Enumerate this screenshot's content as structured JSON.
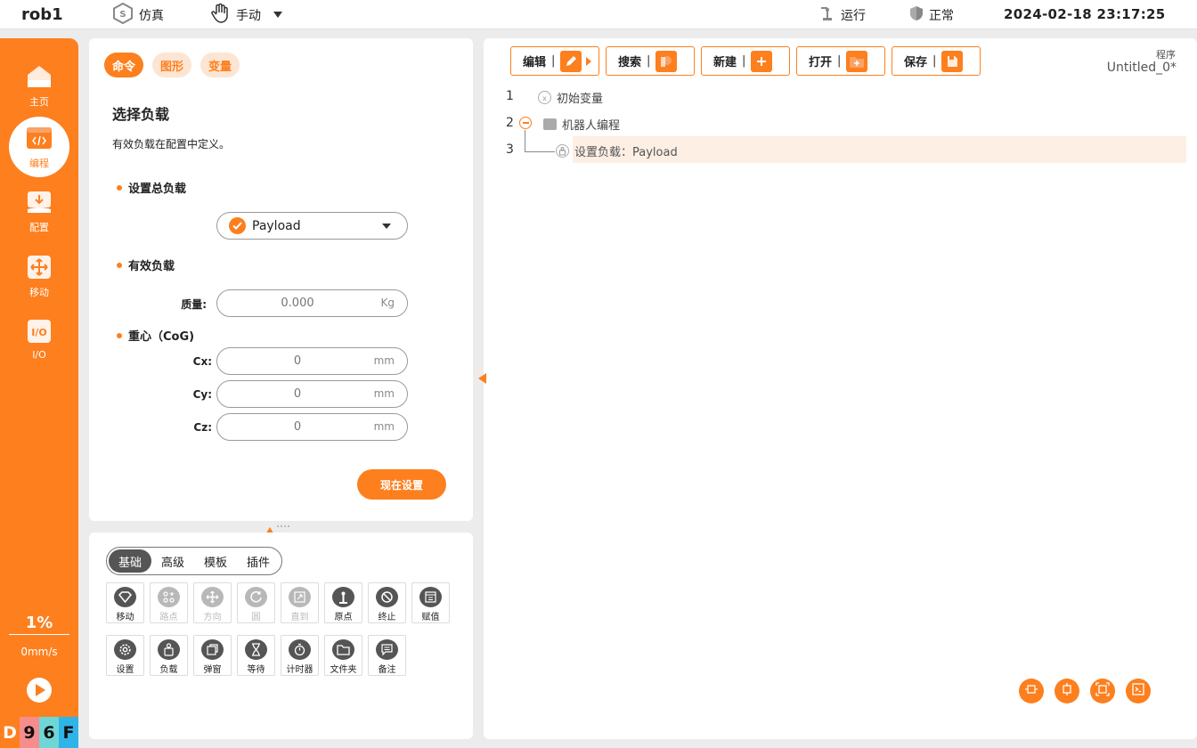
{
  "topbar": {
    "robot": "rob1",
    "sim_label": "仿真",
    "mode_label": "手动",
    "run_label": "运行",
    "status_label": "正常",
    "datetime": "2024-02-18 23:17:25"
  },
  "sidebar": {
    "items": [
      {
        "label": "主页",
        "icon": "home-icon"
      },
      {
        "label": "编程",
        "icon": "code-icon"
      },
      {
        "label": "配置",
        "icon": "config-icon"
      },
      {
        "label": "移动",
        "icon": "move-icon"
      },
      {
        "label": "I/O",
        "icon": "io-icon"
      }
    ],
    "active": "编程",
    "speed_percent": "1%",
    "speed_value": "0mm/s",
    "hex_chars": [
      "D",
      "9",
      "6",
      "F"
    ]
  },
  "cmd_panel": {
    "tabs": [
      "命令",
      "图形",
      "变量"
    ],
    "active_tab": "命令",
    "title": "选择负载",
    "description": "有效负载在配置中定义。",
    "set_total_label": "设置总负载",
    "payload_select": "Payload",
    "effective_label": "有效负载",
    "mass_label": "质量:",
    "mass_placeholder": "0.000",
    "mass_unit": "Kg",
    "cog_label": "重心（CoG)",
    "cx_label": "Cx:",
    "cy_label": "Cy:",
    "cz_label": "Cz:",
    "cx_placeholder": "0",
    "cy_placeholder": "0",
    "cz_placeholder": "0",
    "coord_unit": "mm",
    "set_now": "现在设置"
  },
  "toolbox": {
    "segments": [
      "基础",
      "高级",
      "模板",
      "插件"
    ],
    "active_segment": "基础",
    "tools_row1": [
      {
        "label": "移动",
        "icon": "move-cmd-icon",
        "enabled": true
      },
      {
        "label": "路点",
        "icon": "waypoint-icon",
        "enabled": false
      },
      {
        "label": "方向",
        "icon": "direction-icon",
        "enabled": false
      },
      {
        "label": "圆",
        "icon": "circle-icon",
        "enabled": false
      },
      {
        "label": "直到",
        "icon": "until-icon",
        "enabled": false
      },
      {
        "label": "原点",
        "icon": "origin-icon",
        "enabled": true
      },
      {
        "label": "终止",
        "icon": "stop-icon",
        "enabled": true
      },
      {
        "label": "赋值",
        "icon": "assign-icon",
        "enabled": true
      }
    ],
    "tools_row2": [
      {
        "label": "设置",
        "icon": "settings-icon",
        "enabled": true
      },
      {
        "label": "负载",
        "icon": "payload-icon",
        "enabled": true
      },
      {
        "label": "弹窗",
        "icon": "popup-icon",
        "enabled": true
      },
      {
        "label": "等待",
        "icon": "wait-icon",
        "enabled": true
      },
      {
        "label": "计时器",
        "icon": "timer-icon",
        "enabled": true
      },
      {
        "label": "文件夹",
        "icon": "folder-icon",
        "enabled": true
      },
      {
        "label": "备注",
        "icon": "note-icon",
        "enabled": true
      }
    ]
  },
  "program": {
    "buttons": [
      "编辑",
      "搜索",
      "新建",
      "打开",
      "保存"
    ],
    "program_label": "程序",
    "program_name": "Untitled_0*",
    "lines": [
      {
        "no": "1",
        "text": "初始变量"
      },
      {
        "no": "2",
        "text": "机器人编程"
      },
      {
        "no": "3",
        "text": "设置负载：Payload"
      }
    ]
  },
  "colors": {
    "accent": "#fd7f1e",
    "accent_light": "#fde5d3",
    "highlight_row": "#fdefe4"
  }
}
